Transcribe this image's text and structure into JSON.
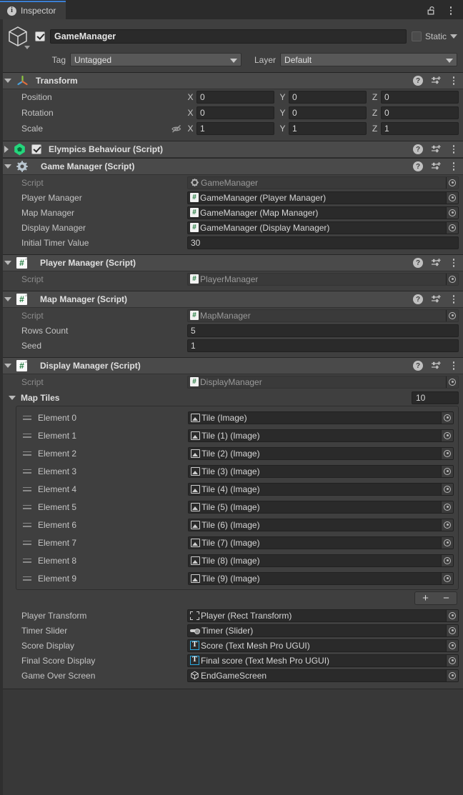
{
  "window": {
    "tab_label": "Inspector",
    "tab_icon": "info-icon",
    "lock_icon": "padlock-open-icon",
    "menu_icon": "kebab-menu-icon",
    "accent_color": "#3b7fd4",
    "bg_color": "#383838"
  },
  "gameobject": {
    "icon": "cube-icon",
    "enabled": true,
    "name": "GameManager",
    "static_label": "Static",
    "static_checked": false,
    "tag_label": "Tag",
    "tag_value": "Untagged",
    "layer_label": "Layer",
    "layer_value": "Default"
  },
  "transform": {
    "title": "Transform",
    "icon": "transform-gizmo-icon",
    "expanded": true,
    "header_icons": [
      "help-icon",
      "preset-icon",
      "kebab-menu-icon"
    ],
    "constrain_icon": "eye-off-icon",
    "rows": [
      {
        "label": "Position",
        "x": "0",
        "y": "0",
        "z": "0",
        "has_constrain": false
      },
      {
        "label": "Rotation",
        "x": "0",
        "y": "0",
        "z": "0",
        "has_constrain": false
      },
      {
        "label": "Scale",
        "x": "1",
        "y": "1",
        "z": "1",
        "has_constrain": true
      }
    ],
    "axis_labels": [
      "X",
      "Y",
      "Z"
    ]
  },
  "elympics": {
    "title": "Elympics Behaviour (Script)",
    "icon": "elympics-gem-icon",
    "expanded": false,
    "enabled": true
  },
  "game_manager": {
    "title": "Game Manager (Script)",
    "icon": "gear-icon",
    "expanded": true,
    "fields": [
      {
        "label": "Script",
        "value": "GameManager",
        "icon": "gear-icon",
        "disabled": true,
        "type": "object"
      },
      {
        "label": "Player Manager",
        "value": "GameManager (Player Manager)",
        "icon": "csharp-script-icon",
        "disabled": false,
        "type": "object"
      },
      {
        "label": "Map Manager",
        "value": "GameManager (Map Manager)",
        "icon": "csharp-script-icon",
        "disabled": false,
        "type": "object"
      },
      {
        "label": "Display Manager",
        "value": "GameManager (Display Manager)",
        "icon": "csharp-script-icon",
        "disabled": false,
        "type": "object"
      },
      {
        "label": "Initial Timer Value",
        "value": "30",
        "icon": "",
        "disabled": false,
        "type": "number"
      }
    ]
  },
  "player_manager": {
    "title": "Player Manager (Script)",
    "icon": "csharp-script-icon",
    "expanded": true,
    "fields": [
      {
        "label": "Script",
        "value": "PlayerManager",
        "icon": "csharp-script-icon",
        "disabled": true,
        "type": "object"
      }
    ]
  },
  "map_manager": {
    "title": "Map Manager (Script)",
    "icon": "csharp-script-icon",
    "expanded": true,
    "fields": [
      {
        "label": "Script",
        "value": "MapManager",
        "icon": "csharp-script-icon",
        "disabled": true,
        "type": "object"
      },
      {
        "label": "Rows Count",
        "value": "5",
        "icon": "",
        "disabled": false,
        "type": "number"
      },
      {
        "label": "Seed",
        "value": "1",
        "icon": "",
        "disabled": false,
        "type": "number"
      }
    ]
  },
  "display_manager": {
    "title": "Display Manager (Script)",
    "icon": "csharp-script-icon",
    "expanded": true,
    "script_field": {
      "label": "Script",
      "value": "DisplayManager",
      "icon": "csharp-script-icon",
      "disabled": true,
      "type": "object"
    },
    "map_tiles": {
      "label": "Map Tiles",
      "size": "10",
      "expanded": true,
      "elements": [
        {
          "label": "Element 0",
          "value": "Tile (Image)",
          "icon": "image-component-icon"
        },
        {
          "label": "Element 1",
          "value": "Tile (1) (Image)",
          "icon": "image-component-icon"
        },
        {
          "label": "Element 2",
          "value": "Tile (2) (Image)",
          "icon": "image-component-icon"
        },
        {
          "label": "Element 3",
          "value": "Tile (3) (Image)",
          "icon": "image-component-icon"
        },
        {
          "label": "Element 4",
          "value": "Tile (4) (Image)",
          "icon": "image-component-icon"
        },
        {
          "label": "Element 5",
          "value": "Tile (5) (Image)",
          "icon": "image-component-icon"
        },
        {
          "label": "Element 6",
          "value": "Tile (6) (Image)",
          "icon": "image-component-icon"
        },
        {
          "label": "Element 7",
          "value": "Tile (7) (Image)",
          "icon": "image-component-icon"
        },
        {
          "label": "Element 8",
          "value": "Tile (8) (Image)",
          "icon": "image-component-icon"
        },
        {
          "label": "Element 9",
          "value": "Tile (9) (Image)",
          "icon": "image-component-icon"
        }
      ],
      "add_label": "+",
      "remove_label": "−"
    },
    "fields": [
      {
        "label": "Player Transform",
        "value": "Player (Rect Transform)",
        "icon": "rect-transform-icon",
        "disabled": false,
        "type": "object"
      },
      {
        "label": "Timer Slider",
        "value": "Timer (Slider)",
        "icon": "slider-icon",
        "disabled": false,
        "type": "object"
      },
      {
        "label": "Score Display",
        "value": "Score (Text Mesh Pro UGUI)",
        "icon": "textmeshpro-icon",
        "disabled": false,
        "type": "object"
      },
      {
        "label": "Final Score Display",
        "value": "Final score (Text Mesh Pro UGUI)",
        "icon": "textmeshpro-icon",
        "disabled": false,
        "type": "object"
      },
      {
        "label": "Game Over Screen",
        "value": "EndGameScreen",
        "icon": "gameobject-cube-icon",
        "disabled": false,
        "type": "object"
      }
    ]
  }
}
